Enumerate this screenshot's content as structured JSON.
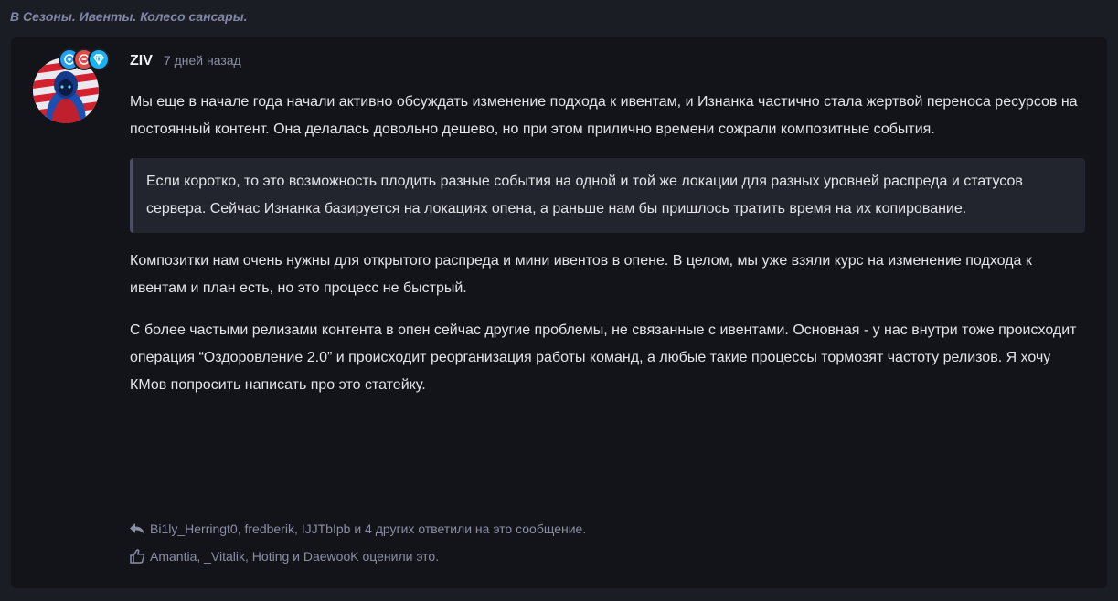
{
  "breadcrumb": {
    "category": "В Сезоны.",
    "topic": "Ивенты. Колесо сансары."
  },
  "post": {
    "author": "ZIV",
    "time_ago": "7 дней назад",
    "paragraph1": "Мы еще в начале года начали активно обсуждать изменение подхода к ивентам, и Изнанка частично стала жертвой переноса ресурсов на постоянный контент. Она делалась довольно дешево, но при этом прилично времени сожрали композитные события.",
    "quote": "Если коротко, то это возможность плодить разные события на одной и той же локации для разных уровней распреда и статусов сервера. Сейчас Изнанка базируется на локациях опена, а раньше нам бы пришлось тратить время на их копирование.",
    "paragraph2": "Композитки нам очень нужны для открытого распреда и мини ивентов в опене. В целом, мы уже взяли курс на изменение подхода к ивентам и план есть, но это процесс не быстрый.",
    "paragraph3": "С более частыми релизами контента в опен сейчас другие проблемы, не связанные с ивентами. Основная - у нас внутри тоже происходит операция “Оздоровление 2.0” и происходит реорганизация работы команд, а любые такие процессы тормозят частоту релизов. Я хочу КМов попросить написать про это статейку."
  },
  "footer": {
    "replies_text": "Bi1ly_Herringt0, fredberik, IJJTbIpb и 4 других ответили на это сообщение.",
    "likes_text": "Amantia, _Vitalik, Hoting и DaewooK оценили это."
  },
  "icons": {
    "reply": "reply-arrow-icon",
    "like": "thumbs-up-icon",
    "badges": [
      "badge-icon",
      "badge-icon",
      "diamond-icon"
    ]
  },
  "colors": {
    "page_bg": "#1b1d24",
    "card_bg": "#13141a",
    "quote_bg": "#23252e",
    "muted_text": "#8a8ea2",
    "badge_blue": "#1ea1f2",
    "badge_red": "#e24a4a"
  }
}
